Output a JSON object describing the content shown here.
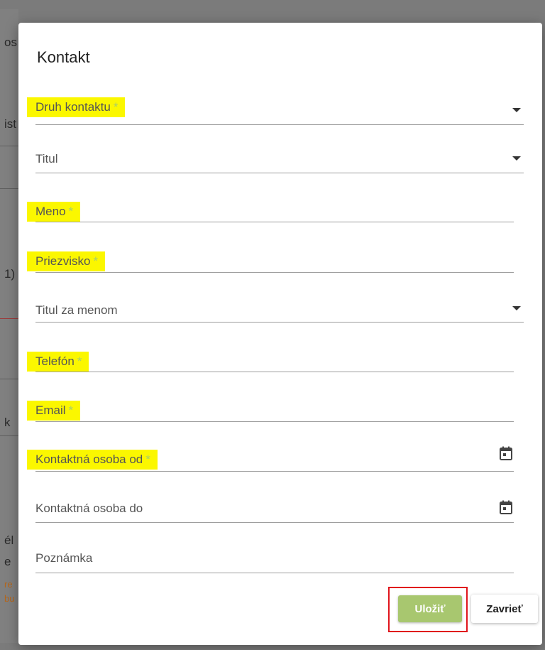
{
  "background": {
    "fragments": [
      "os",
      "ist",
      "1)",
      "k",
      "él",
      "e",
      "re",
      "bu"
    ]
  },
  "dialog": {
    "title": "Kontakt",
    "fields": [
      {
        "label": "Druh kontaktu",
        "required": "*",
        "type": "select",
        "highlighted": true
      },
      {
        "label": "Titul",
        "type": "select"
      },
      {
        "label": "Meno",
        "required": "*",
        "type": "text",
        "highlighted": true
      },
      {
        "label": "Priezvisko",
        "required": "*",
        "type": "text",
        "highlighted": true
      },
      {
        "label": "Titul za menom",
        "type": "select"
      },
      {
        "label": "Telefón",
        "required": "*",
        "type": "text",
        "highlighted": true
      },
      {
        "label": "Email",
        "required": "*",
        "type": "text",
        "highlighted": true
      },
      {
        "label": "Kontaktná osoba od",
        "required": "*",
        "type": "date",
        "highlighted": true
      },
      {
        "label": "Kontaktná osoba do",
        "type": "date"
      },
      {
        "label": "Poznámka",
        "type": "text"
      }
    ],
    "buttons": {
      "save": "Uložiť",
      "close": "Zavrieť"
    }
  },
  "colors": {
    "highlight": "#fbf700",
    "required_asterisk": "#a8cf6a",
    "save_button": "#a8c76f",
    "save_outline": "#e0141c"
  },
  "icons": {
    "select": "chevron-down-icon",
    "date": "calendar-icon"
  }
}
